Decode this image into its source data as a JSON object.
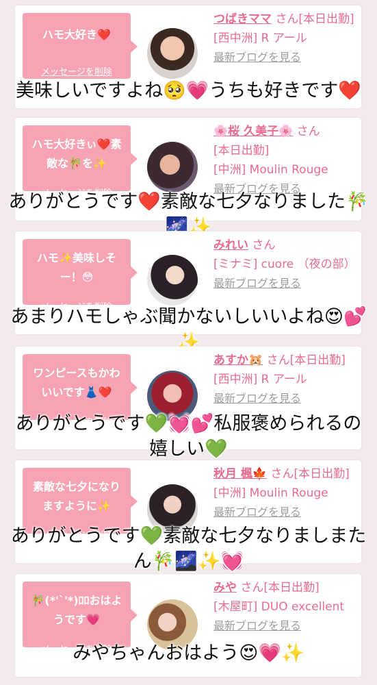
{
  "delete_label": "メッセージを削除",
  "cards": [
    {
      "message": "ハモ大好き❤️",
      "name": "つばきママ",
      "san": "さん[本日出勤]",
      "shop": "[西中洲] R アール",
      "blog": "最新ブログを見る",
      "reply": "美味しいですよね🥺💗うちも好きです❤️"
    },
    {
      "message": "ハモ大好きぃ❤️素敵な🎋を✨",
      "name": "🌸桜 久美子🌸",
      "san": "さん",
      "status": "[本日出勤]",
      "shop": "[中洲] Moulin Rouge",
      "blog": "最新ブログを見る",
      "reply": "ありがとうです❤️素敵な七夕なりました🎋🌌✨"
    },
    {
      "message": "ハモ✨美味しそー！😳",
      "name": "みれい",
      "san": "さん",
      "shop": "[ミナミ] cuore （夜の部）",
      "blog": "最新ブログを見る",
      "reply": "あまりハモしゃぶ聞かないしいいよね😍💕✨"
    },
    {
      "message": "ワンピースもかわいいです👗❤️",
      "name": "あすか🐹",
      "san": "さん[本日出勤]",
      "shop": "[西中洲] R アール",
      "blog": "最新ブログを見る",
      "reply": "ありがとうです💚💓💕私服褒められるの嬉しい💚"
    },
    {
      "message": "素敵な七夕になりますように✨",
      "name": "秋月 楓🍁",
      "san": "さん[本日出勤]",
      "shop": "[中洲] Moulin Rouge",
      "blog": "最新ブログを見る",
      "reply": "ありがとうです💚素敵な七夕なりましまたん🎋🌌✨💓"
    },
    {
      "message": "🎋(*'`'*)ﾛﾛおはようです💗",
      "name": "みや",
      "san": "さん[本日出勤]",
      "shop": "[木屋町] DUO excellent",
      "blog": "最新ブログを見る",
      "reply": "みやちゃんおはよう😍💗✨"
    }
  ],
  "colors": {
    "background": "#f2eaec",
    "bubble": "#f7a3b3",
    "name_pink": "#e86b8e"
  }
}
